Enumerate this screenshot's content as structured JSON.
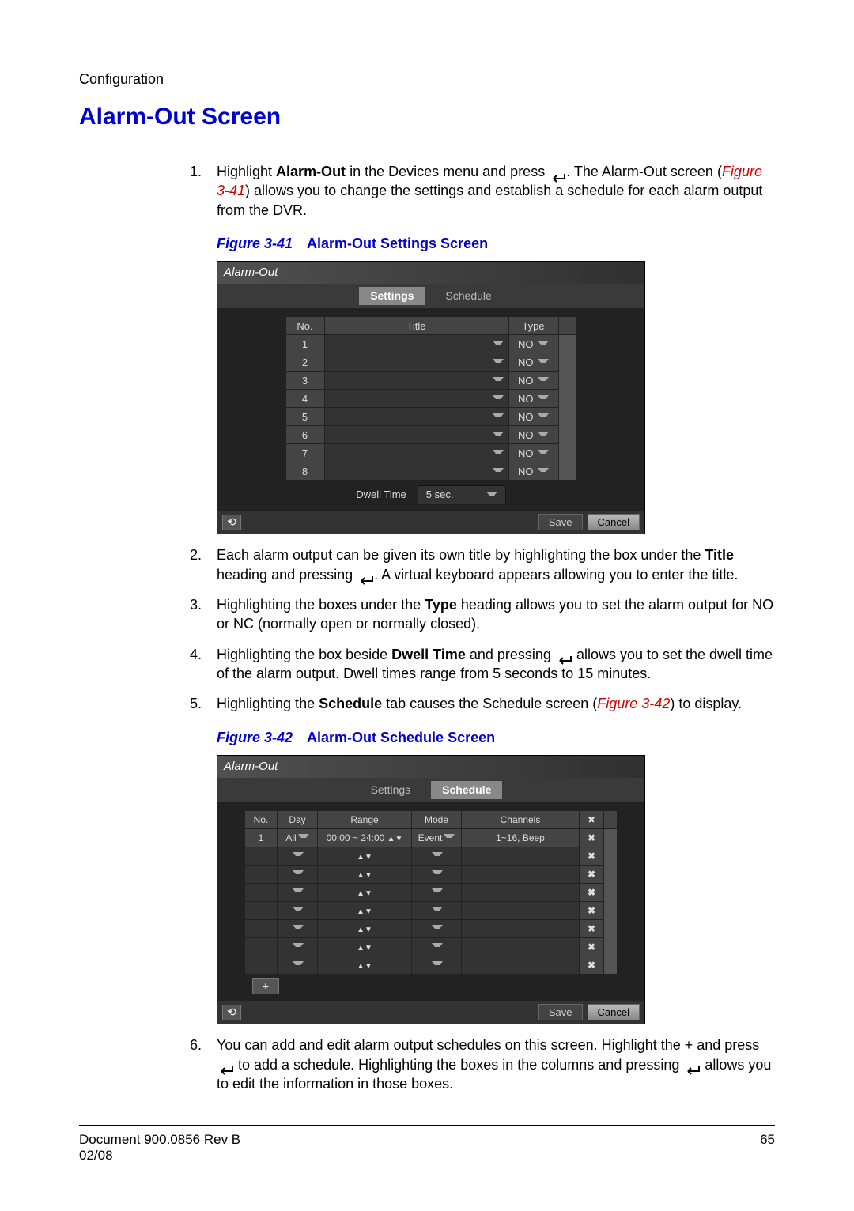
{
  "header": {
    "section": "Configuration"
  },
  "title": "Alarm-Out Screen",
  "steps": {
    "s1a": "Highlight ",
    "s1b": "Alarm-Out",
    "s1c": " in the Devices menu and press ",
    "s1d": ". The Alarm-Out screen (",
    "s1ref": "Figure 3-41",
    "s1e": ") allows you to change the settings and establish a schedule for each alarm output from the DVR.",
    "s2a": "Each alarm output can be given its own title by highlighting the box under the ",
    "s2b": "Title",
    "s2c": " heading and pressing ",
    "s2d": ". A virtual keyboard appears allowing you to enter the title.",
    "s3a": "Highlighting the boxes under the ",
    "s3b": "Type",
    "s3c": " heading allows you to set the alarm output for NO or NC (normally open or normally closed).",
    "s4a": "Highlighting the box beside ",
    "s4b": "Dwell Time",
    "s4c": " and pressing ",
    "s4d": " allows you to set the dwell time of the alarm output. Dwell times range from 5 seconds to 15 minutes.",
    "s5a": "Highlighting the ",
    "s5b": "Schedule",
    "s5c": " tab causes the Schedule screen (",
    "s5ref": "Figure 3-42",
    "s5d": ") to display.",
    "s6a": "You can add and edit alarm output schedules on this screen. Highlight the ",
    "s6plus": "+",
    "s6b": " and press ",
    "s6c": " to add a schedule. Highlighting the boxes in the columns and pressing ",
    "s6d": " allows you to edit the information in those boxes."
  },
  "fig41": {
    "label": "Figure 3-41",
    "title": "Alarm-Out Settings Screen"
  },
  "fig42": {
    "label": "Figure 3-42",
    "title": "Alarm-Out Schedule Screen"
  },
  "screen1": {
    "title": "Alarm-Out",
    "tab_settings": "Settings",
    "tab_schedule": "Schedule",
    "col_no": "No.",
    "col_title": "Title",
    "col_type": "Type",
    "rows": [
      {
        "no": "1",
        "type": "NO"
      },
      {
        "no": "2",
        "type": "NO"
      },
      {
        "no": "3",
        "type": "NO"
      },
      {
        "no": "4",
        "type": "NO"
      },
      {
        "no": "5",
        "type": "NO"
      },
      {
        "no": "6",
        "type": "NO"
      },
      {
        "no": "7",
        "type": "NO"
      },
      {
        "no": "8",
        "type": "NO"
      }
    ],
    "dwell_label": "Dwell Time",
    "dwell_value": "5 sec.",
    "save": "Save",
    "cancel": "Cancel"
  },
  "screen2": {
    "title": "Alarm-Out",
    "tab_settings": "Settings",
    "tab_schedule": "Schedule",
    "col_no": "No.",
    "col_day": "Day",
    "col_range": "Range",
    "col_mode": "Mode",
    "col_channels": "Channels",
    "col_x": "✖",
    "row1": {
      "no": "1",
      "day": "All",
      "range": "00:00 ~ 24:00",
      "mode": "Event",
      "channels": "1~16, Beep"
    },
    "add": "+",
    "save": "Save",
    "cancel": "Cancel"
  },
  "footer": {
    "doc": "Document 900.0856 Rev B",
    "date": "02/08",
    "page": "65"
  }
}
